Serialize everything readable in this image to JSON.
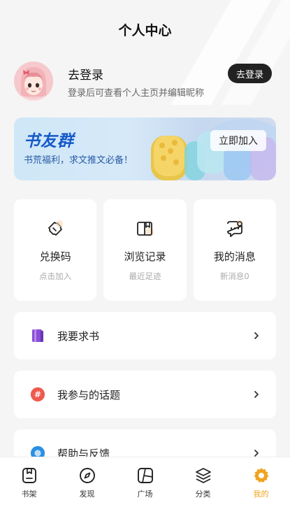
{
  "header": {
    "title": "个人中心"
  },
  "profile": {
    "name": "去登录",
    "description": "登录后可查看个人主页并编辑昵称",
    "login_button": "去登录"
  },
  "banner": {
    "title": "书友群",
    "subtitle": "书荒福利，求文推文必备！",
    "join_button": "立即加入"
  },
  "quick_cards": [
    {
      "label": "兑换码",
      "sub": "点击加入",
      "icon": "ticket-icon"
    },
    {
      "label": "浏览记录",
      "sub": "最近足迹",
      "icon": "book-open-icon"
    },
    {
      "label": "我的消息",
      "sub": "新消息0",
      "icon": "message-icon"
    }
  ],
  "menu": [
    {
      "label": "我要求书",
      "icon": "book-request-icon",
      "color": "#8a4fd6"
    },
    {
      "label": "我参与的话题",
      "icon": "hashtag-icon",
      "color": "#ee5a4e"
    },
    {
      "label": "帮助与反馈",
      "icon": "help-icon",
      "color": "#2b8fe3"
    }
  ],
  "tabs": [
    {
      "label": "书架",
      "icon": "bookshelf-icon"
    },
    {
      "label": "发现",
      "icon": "compass-icon"
    },
    {
      "label": "广场",
      "icon": "square-icon"
    },
    {
      "label": "分类",
      "icon": "layers-icon"
    },
    {
      "label": "我的",
      "icon": "gear-icon",
      "active": true
    }
  ],
  "colors": {
    "accent": "#f0a31f",
    "banner_text": "#1559c9",
    "dark_button": "#222222"
  }
}
